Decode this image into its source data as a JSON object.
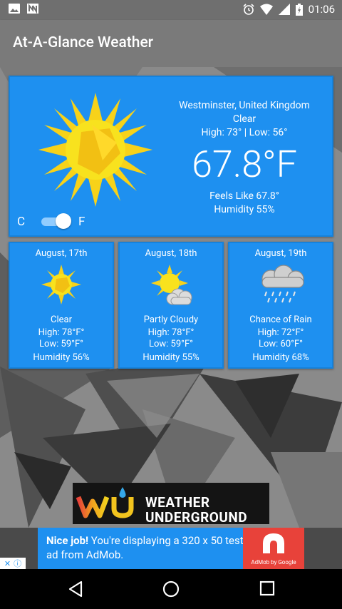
{
  "status_bar": {
    "time": "01:06"
  },
  "app_bar": {
    "title": "At-A-Glance Weather"
  },
  "current": {
    "location": "Westminster, United Kingdom",
    "condition": "Clear",
    "high_low": "High: 73° | Low: 56°",
    "temperature": "67.8°F",
    "feels_like": "Feels Like 67.8°",
    "humidity": "Humidity 55%",
    "unit_c": "C",
    "unit_f": "F",
    "unit_toggle_on": true
  },
  "forecast": [
    {
      "date": "August, 17th",
      "condition": "Clear",
      "high": "High: 78°F°",
      "low": "Low: 59°F°",
      "humidity": "Humidity 56%",
      "icon": "sun-icon"
    },
    {
      "date": "August, 18th",
      "condition": "Partly Cloudy",
      "high": "High: 78°F°",
      "low": "Low: 59°F°",
      "humidity": "Humidity 55%",
      "icon": "partly-cloudy-icon"
    },
    {
      "date": "August, 19th",
      "condition": "Chance of Rain",
      "high": "High: 72°F°",
      "low": "Low: 60°F°",
      "humidity": "Humidity 68%",
      "icon": "rain-cloud-icon"
    }
  ],
  "logo": {
    "line1": "WEATHER",
    "line2": "UNDERGROUND"
  },
  "ad": {
    "bold": "Nice job!",
    "text": " You're displaying a 320 x 50 test ad from AdMob.",
    "provider": "AdMob by Google"
  },
  "colors": {
    "card": "#1e90f0",
    "appbar": "#7a7a7a",
    "ad_red": "#e8423a"
  }
}
